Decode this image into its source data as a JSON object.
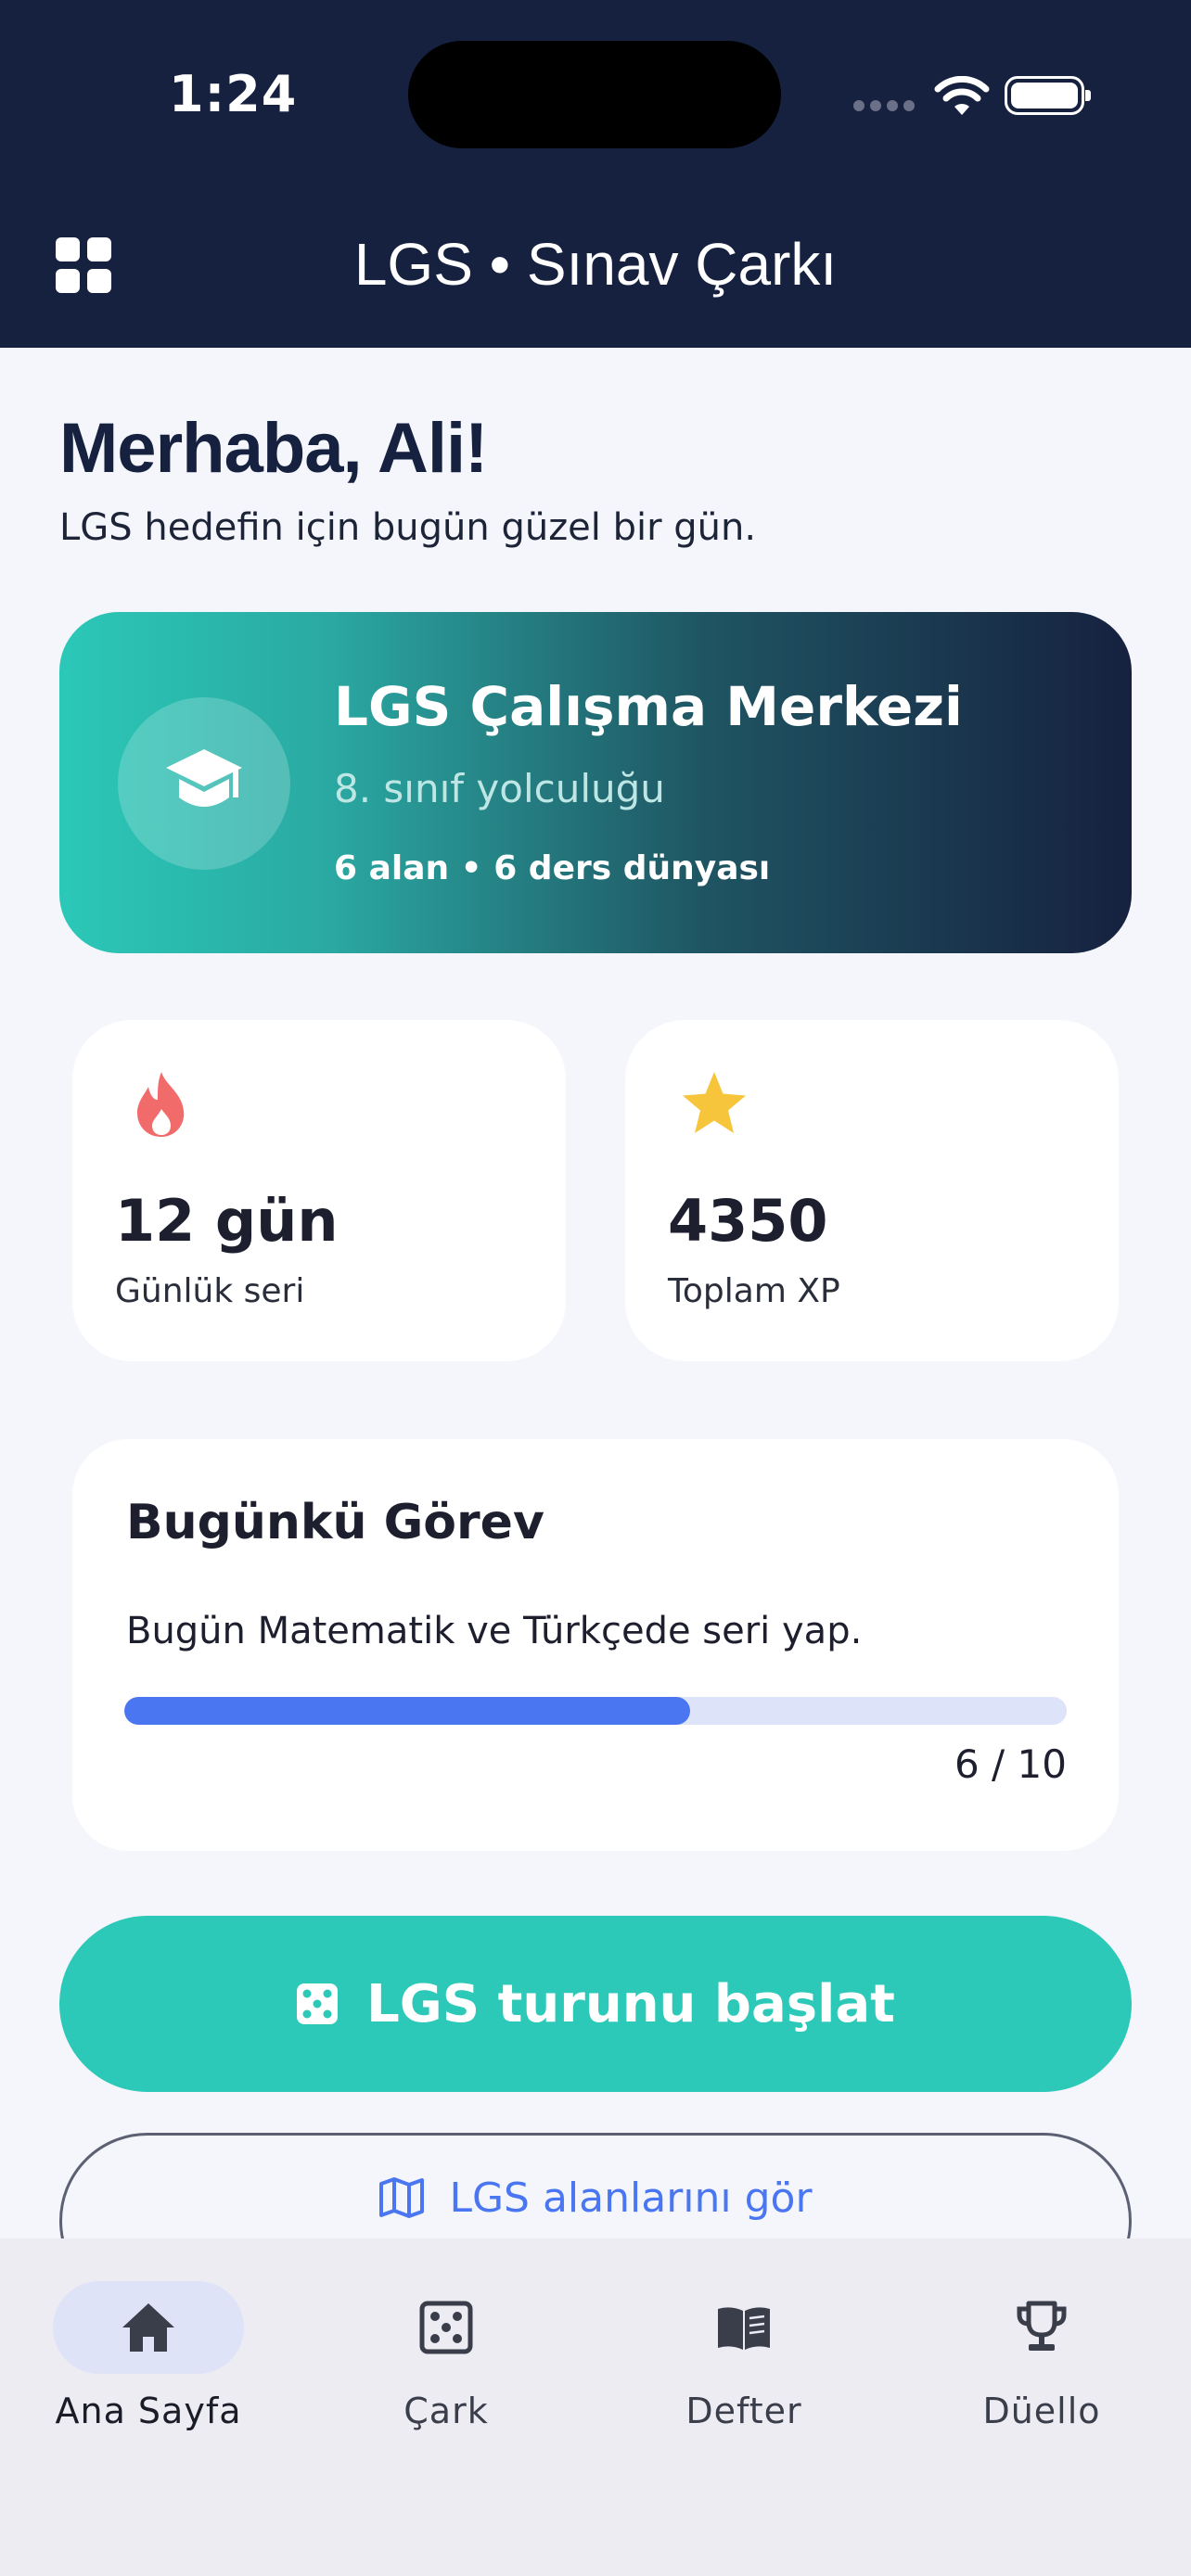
{
  "status_bar": {
    "time": "1:24"
  },
  "app_bar": {
    "title": "LGS • Sınav Çarkı",
    "menu_icon": "grid-icon"
  },
  "greeting": {
    "title": "Merhaba, Ali!",
    "subtitle": "LGS hedefin için bugün güzel bir gün."
  },
  "hero": {
    "icon": "graduation-cap-icon",
    "title": "LGS Çalışma Merkezi",
    "subtitle": "8. sınıf yolculuğu",
    "meta": "6 alan • 6 ders dünyası",
    "colors": {
      "gradient_start": "#2bc8b8",
      "gradient_end": "#16213f"
    }
  },
  "stats": [
    {
      "icon": "flame-icon",
      "icon_color": "#f26b6b",
      "value": "12 gün",
      "label": "Günlük seri"
    },
    {
      "icon": "star-icon",
      "icon_color": "#f7c53b",
      "value": "4350",
      "label": "Toplam XP"
    }
  ],
  "daily_task": {
    "title": "Bugünkü Görev",
    "description": "Bugün Matematik ve Türkçede seri yap.",
    "progress_text": "6 / 10",
    "progress_fraction": 0.6,
    "progress_color": "#4b76f2"
  },
  "actions": {
    "primary": {
      "label": "LGS turunu başlat",
      "icon": "dice-icon",
      "color": "#2cc9b8"
    },
    "secondary": {
      "label": "LGS alanlarını gör",
      "icon": "map-icon"
    }
  },
  "bottom_nav": [
    {
      "label": "Ana Sayfa",
      "icon": "home-icon",
      "active": true
    },
    {
      "label": "Çark",
      "icon": "dice-icon",
      "active": false
    },
    {
      "label": "Defter",
      "icon": "book-icon",
      "active": false
    },
    {
      "label": "Düello",
      "icon": "trophy-icon",
      "active": false
    }
  ]
}
